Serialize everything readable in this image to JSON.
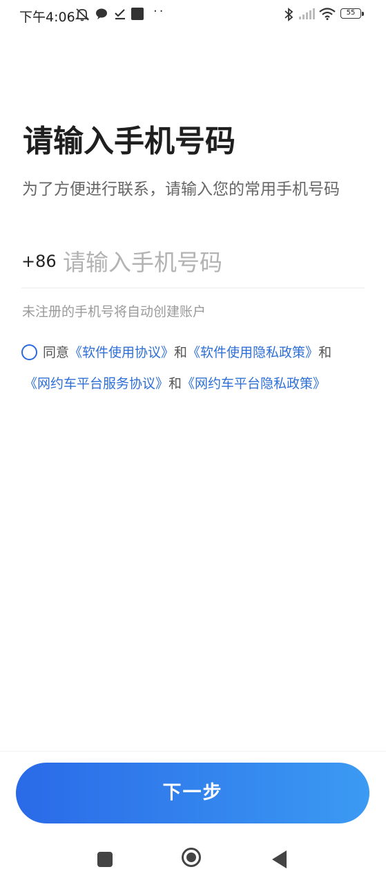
{
  "status_bar": {
    "time": "下午4:06",
    "battery": "55",
    "icons": [
      "mute-icon",
      "chat-bubble-icon",
      "checkmark-icon",
      "app-square-icon",
      "more-dots-icon",
      "bluetooth-icon",
      "signal-icon",
      "wifi-icon",
      "battery-icon"
    ]
  },
  "header": {
    "title": "请输入手机号码",
    "subtitle": "为了方便进行联系，请输入您的常用手机号码"
  },
  "phone": {
    "country_code": "+86",
    "placeholder": "请输入手机号码",
    "value": ""
  },
  "hint": "未注册的手机号将自动创建账户",
  "agreement": {
    "checked": false,
    "prefix": "同意",
    "link1": "《软件使用协议》",
    "and1": "和",
    "link2": "《软件使用隐私政策》",
    "and2": "和",
    "link3": "《网约车平台服务协议》",
    "and3": "和",
    "link4": "《网约车平台隐私政策》"
  },
  "next_button": {
    "label": "下一步"
  },
  "colors": {
    "accent": "#2d6fd6",
    "button_start": "#2a6ae8",
    "button_end": "#3b9af2"
  },
  "nav_bar": {
    "icons": [
      "recent-apps-icon",
      "home-icon",
      "back-icon"
    ]
  }
}
